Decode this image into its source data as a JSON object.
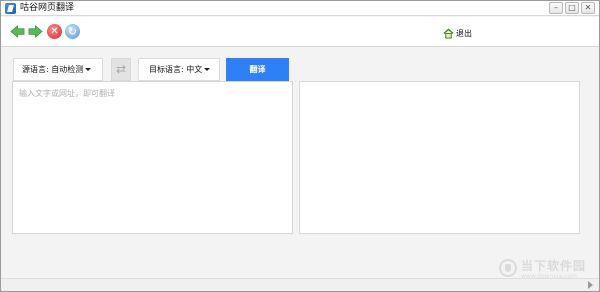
{
  "window": {
    "title": "咕谷网页翻译",
    "controls": {
      "minimize": "–",
      "maximize": "□",
      "close": "✕"
    }
  },
  "toolbar": {
    "icons": [
      "back-arrow-icon",
      "forward-arrow-icon",
      "stop-icon",
      "refresh-icon"
    ],
    "exit_label": "退出"
  },
  "translator": {
    "source_language": "源语言: 自动检测",
    "target_language": "目标语言: 中文",
    "translate_label": "翻译",
    "input_placeholder": "输入文字或网址，即可翻译",
    "output_text": ""
  },
  "watermark": {
    "text": "当下软件园",
    "sub": "www.downxia.com"
  },
  "colors": {
    "accent": "#2f7ff7",
    "back_forward_arrow": "#5cb85c",
    "stop": "#d62626"
  }
}
